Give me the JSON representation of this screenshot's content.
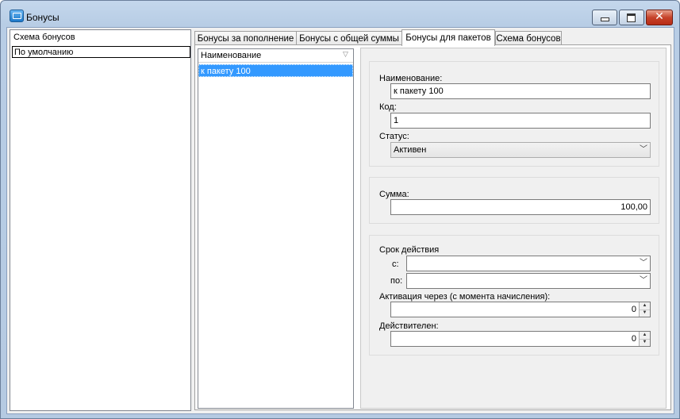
{
  "window": {
    "title": "Бонусы"
  },
  "left_panel": {
    "header": "Схема бонусов",
    "items": [
      "По умолчанию"
    ]
  },
  "tabs": [
    "Бонусы за пополнение",
    "Бонусы с общей суммы",
    "Бонусы для пакетов",
    "Схема бонусов"
  ],
  "active_tab": "Бонусы для пакетов",
  "list": {
    "column": "Наименование",
    "rows": [
      "к пакету 100"
    ]
  },
  "form": {
    "name_label": "Наименование:",
    "name_value": "к пакету 100",
    "code_label": "Код:",
    "code_value": "1",
    "status_label": "Статус:",
    "status_value": "Активен",
    "sum_label": "Сумма:",
    "sum_value": "100,00",
    "validity_label": "Срок действия",
    "from_label": "с:",
    "from_value": "",
    "to_label": "по:",
    "to_value": "",
    "activation_label": "Активация через (с момента начисления):",
    "activation_value": "0",
    "valid_label": "Действителен:",
    "valid_value": "0"
  },
  "icons": {
    "app": "bonus-app-icon",
    "sort": "sort-indicator-icon",
    "dropdown": "chevron-down-icon"
  }
}
